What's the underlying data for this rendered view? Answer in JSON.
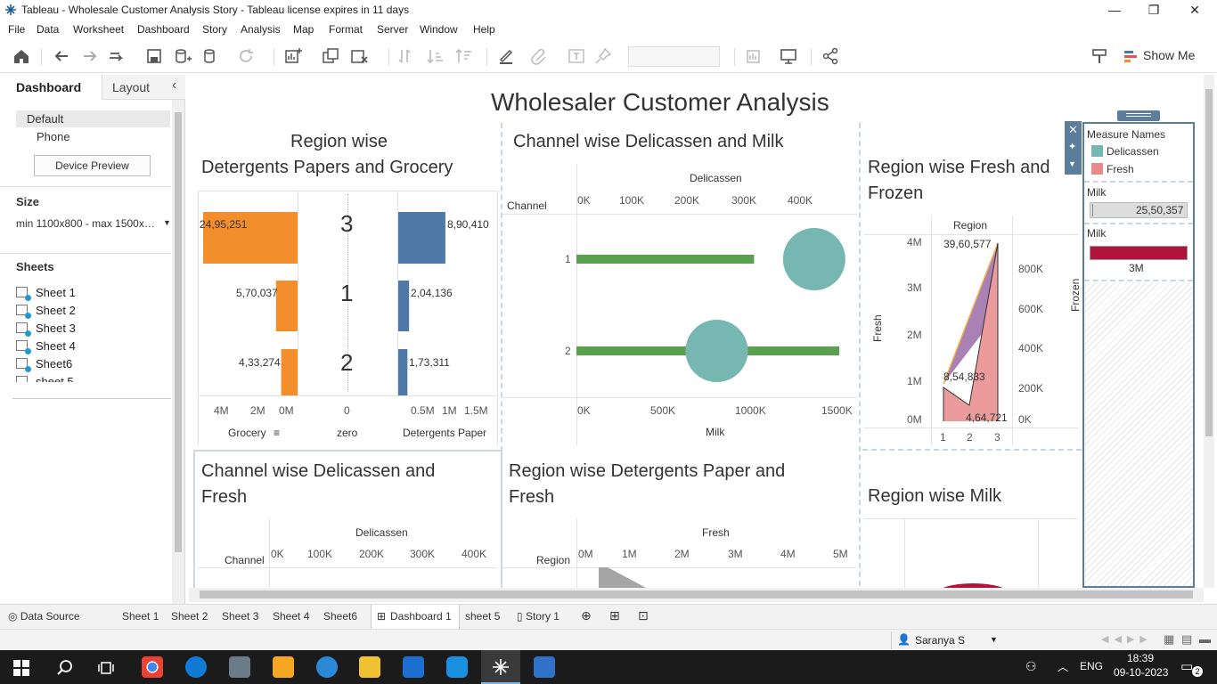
{
  "window": {
    "title": "Tableau - Wholesale Customer Analysis Story - Tableau license expires in 11 days",
    "minimize": "—",
    "restore": "❐",
    "close": "✕"
  },
  "menu": [
    "File",
    "Data",
    "Worksheet",
    "Dashboard",
    "Story",
    "Analysis",
    "Map",
    "Format",
    "Server",
    "Window",
    "Help"
  ],
  "toolbar": {
    "show_me": "Show Me"
  },
  "left_panel": {
    "tab_dashboard": "Dashboard",
    "tab_layout": "Layout",
    "collapse": "‹",
    "devices": [
      "Default",
      "Phone"
    ],
    "device_preview": "Device Preview",
    "size_title": "Size",
    "size_value": "min 1100x800 - max 1500x…",
    "sheets_title": "Sheets",
    "sheets": [
      "Sheet 1",
      "Sheet 2",
      "Sheet 3",
      "Sheet 4",
      "Sheet6",
      "sheet 5"
    ]
  },
  "dashboard": {
    "title": "Wholesaler Customer Analysis",
    "panel1": {
      "title_line1": "Region wise",
      "title_line2": "Detergents Papers and Grocery",
      "rows": [
        {
          "region": "3",
          "grocery_label": "24,95,251",
          "grocery": 2495251,
          "detergents_label": "8,90,410",
          "detergents": 890410
        },
        {
          "region": "1",
          "grocery_label": "5,70,037",
          "grocery": 570037,
          "detergents_label": "2,04,136",
          "detergents": 204136
        },
        {
          "region": "2",
          "grocery_label": "4,33,274",
          "grocery": 433274,
          "detergents_label": "1,73,311",
          "detergents": 173311
        }
      ],
      "grocery_ticks": [
        "4M",
        "2M",
        "0M"
      ],
      "zero_tick": "0",
      "det_ticks": [
        "0.5M",
        "1M",
        "1.5M"
      ],
      "grocery_axis": "Grocery",
      "zero_axis": "zero",
      "det_axis": "Detergents Paper",
      "colors": {
        "grocery": "#f28e2b",
        "detergents": "#4e79a7"
      }
    },
    "panel2": {
      "title": "Channel wise Delicassen and Milk",
      "top_axis": "Delicassen",
      "top_ticks": [
        "0K",
        "100K",
        "200K",
        "300K",
        "400K"
      ],
      "bottom_axis": "Milk",
      "bottom_ticks": [
        "0K",
        "500K",
        "1000K",
        "1500K"
      ],
      "row_header": "Channel",
      "channels": [
        "1",
        "2"
      ],
      "milk": [
        1028614,
        1521743
      ],
      "delicassen": [
        421955,
        248988
      ],
      "colors": {
        "milk": "#59a14f",
        "delicassen": "#76b7b2"
      }
    },
    "panel3": {
      "title_line1": "Region wise  Fresh and",
      "title_line2": "Frozen",
      "col_header": "Region",
      "left_axis": "Fresh",
      "right_axis": "Frozen",
      "left_ticks": [
        "4M",
        "3M",
        "2M",
        "1M",
        "0M"
      ],
      "right_ticks": [
        "800K",
        "600K",
        "400K",
        "200K",
        "0K"
      ],
      "x_ticks": [
        "1",
        "2",
        "3"
      ],
      "labels": [
        "39,60,577",
        "8,54,833",
        "4,64,721"
      ],
      "colors": {
        "fresh": "#e88a8a",
        "frozen": "#9b6ba8"
      }
    },
    "panel4": {
      "title_line1": "Channel wise Delicassen and",
      "title_line2": "Fresh",
      "top_axis": "Delicassen",
      "top_ticks": [
        "0K",
        "100K",
        "200K",
        "300K",
        "400K"
      ],
      "row_header": "Channel"
    },
    "panel5": {
      "title_line1": "Region wise Detergents Paper and",
      "title_line2": "Fresh",
      "top_axis": "Fresh",
      "top_ticks": [
        "0M",
        "1M",
        "2M",
        "3M",
        "4M",
        "5M"
      ],
      "row_header": "Region"
    },
    "panel6": {
      "title": "Region wise  Milk"
    },
    "legend": {
      "title": "Measure Names",
      "items": [
        {
          "name": "Delicassen",
          "color": "#76b7b2"
        },
        {
          "name": "Fresh",
          "color": "#e88a8a"
        }
      ],
      "milk_title_1": "Milk",
      "milk_value": "25,50,357",
      "milk_title_2": "Milk",
      "milk_max": "3M",
      "milk_color": "#b2133b"
    }
  },
  "tabs": [
    "Data Source",
    "Sheet 1",
    "Sheet 2",
    "Sheet 3",
    "Sheet 4",
    "Sheet6",
    "Dashboard 1",
    "sheet 5",
    "Story 1"
  ],
  "active_tab": "Dashboard 1",
  "status": {
    "user": "Saranya S"
  },
  "taskbar": {
    "lang": "ENG",
    "time": "18:39",
    "date": "09-10-2023",
    "notifications": "2"
  }
}
